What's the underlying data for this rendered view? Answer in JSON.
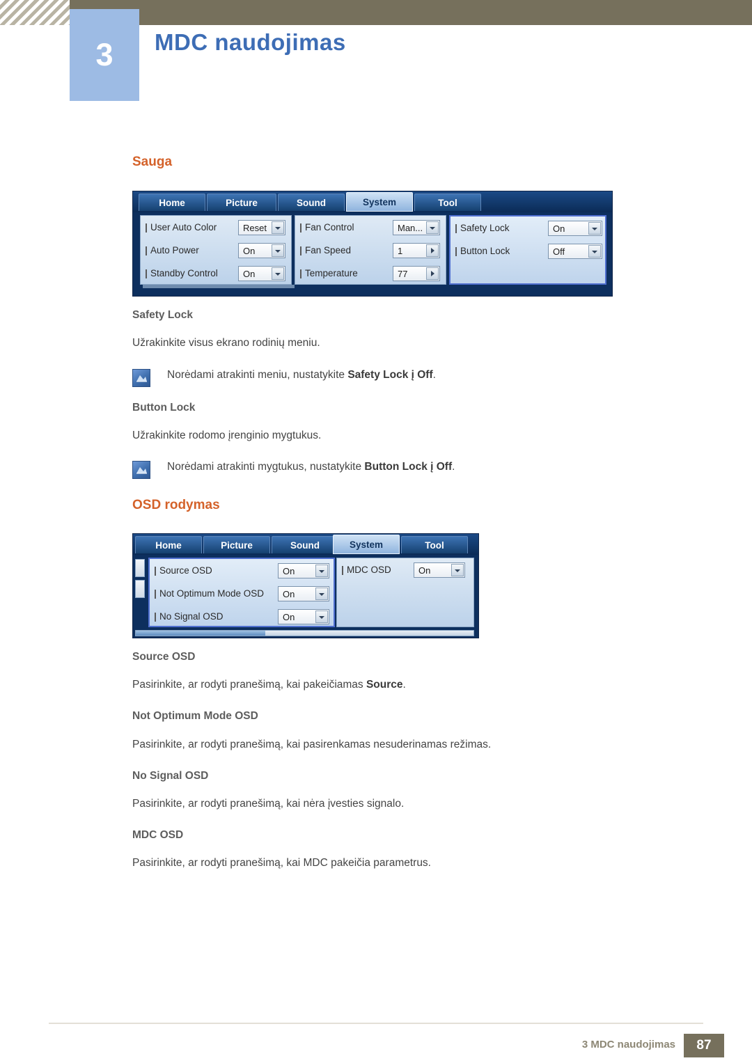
{
  "header": {
    "chapter_number": "3",
    "chapter_title": "MDC naudojimas"
  },
  "sections": [
    {
      "heading": "Sauga",
      "widget": {
        "tabs": [
          "Home",
          "Picture",
          "Sound",
          "System",
          "Tool"
        ],
        "active_tab": "System",
        "groups": [
          {
            "rows": [
              {
                "label": "User Auto Color",
                "value": "Reset",
                "control": "dropdown"
              },
              {
                "label": "Auto Power",
                "value": "On",
                "control": "dropdown"
              },
              {
                "label": "Standby Control",
                "value": "On",
                "control": "dropdown"
              }
            ]
          },
          {
            "rows": [
              {
                "label": "Fan Control",
                "value": "Man...",
                "control": "dropdown"
              },
              {
                "label": "Fan Speed",
                "value": "1",
                "control": "spinner"
              },
              {
                "label": "Temperature",
                "value": "77",
                "control": "spinner"
              }
            ]
          },
          {
            "selected": true,
            "rows": [
              {
                "label": "Safety Lock",
                "value": "On",
                "control": "dropdown"
              },
              {
                "label": "Button Lock",
                "value": "Off",
                "control": "dropdown"
              }
            ]
          }
        ]
      },
      "items": [
        {
          "title": "Safety Lock",
          "text": "Užrakinkite visus ekrano rodinių meniu.",
          "note": {
            "icon": "note-icon",
            "pre": "Norėdami atrakinti meniu, nustatykite ",
            "bold": "Safety Lock į Off",
            "post": "."
          }
        },
        {
          "title": "Button Lock",
          "text": "Užrakinkite rodomo įrenginio mygtukus.",
          "note": {
            "icon": "note-icon",
            "pre": "Norėdami atrakinti mygtukus, nustatykite ",
            "bold": "Button Lock į Off",
            "post": "."
          }
        }
      ]
    },
    {
      "heading": "OSD rodymas",
      "widget": {
        "tabs": [
          "Home",
          "Picture",
          "Sound",
          "System",
          "Tool"
        ],
        "active_tab": "System",
        "groups": [
          {
            "selected": true,
            "rows": [
              {
                "label": "Source OSD",
                "value": "On",
                "control": "dropdown"
              },
              {
                "label": "Not Optimum Mode OSD",
                "value": "On",
                "control": "dropdown"
              },
              {
                "label": "No Signal OSD",
                "value": "On",
                "control": "dropdown"
              }
            ]
          },
          {
            "rows": [
              {
                "label": "MDC OSD",
                "value": "On",
                "control": "dropdown"
              }
            ]
          }
        ]
      },
      "items": [
        {
          "title": "Source OSD",
          "text_pre": "Pasirinkite, ar rodyti pranešimą, kai pakeičiamas ",
          "text_bold": "Source",
          "text_post": "."
        },
        {
          "title": "Not Optimum Mode OSD",
          "text": "Pasirinkite, ar rodyti pranešimą, kai pasirenkamas nesuderinamas režimas."
        },
        {
          "title": "No Signal OSD",
          "text": "Pasirinkite, ar rodyti pranešimą, kai nėra įvesties signalo."
        },
        {
          "title": "MDC OSD",
          "text": "Pasirinkite, ar rodyti pranešimą, kai MDC pakeičia parametrus."
        }
      ]
    }
  ],
  "footer": {
    "text": "3 MDC naudojimas",
    "page": "87"
  },
  "colors": {
    "header_band": "#76705c",
    "chapter_box": "#9dbbe4",
    "chapter_title": "#3d6db5",
    "section_heading": "#d4622a",
    "sub_heading": "#5d5d5d",
    "body": "#444444"
  }
}
